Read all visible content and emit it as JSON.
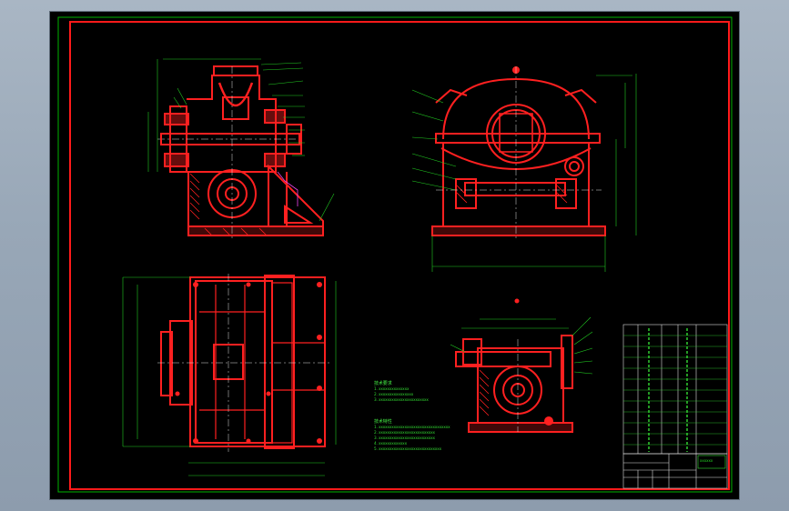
{
  "drawing": {
    "frame_colors": {
      "outer_border": "#00c000",
      "inner_border": "#ff1a1a",
      "part_outline": "#ff2020",
      "dimension": "#22cc22",
      "center_line": "#dddddd",
      "hatch": "#ff2020",
      "background": "#000000"
    },
    "views": [
      "front-section-view",
      "side-view",
      "top-view",
      "partial-section-view"
    ],
    "notes": {
      "block1_title": "技术要求",
      "block1_lines": [
        "1. xxxxxxxxxxxxxx",
        "2. xxxxxxxxxxxxxxxx",
        "3. xxxxxxxxxxxxxxxxxxxxxxx"
      ],
      "block2_title": "技术特性",
      "block2_lines": [
        "1. xxxxxxxxxxxxxxxxxxxxxxxxxxxxxxxxx",
        "2. xxxxxxxxxxxxxxxxxxxxxxxxxx",
        "3. xxxxxxxxxxxxxxxxxxxxxxxxxx",
        "4. xxxxxxxxxxxxx",
        "5. xxxxxxxxxxxxxxxxxxxxxxxxxxxxx"
      ]
    },
    "title_block": {
      "label": "xxxxxx"
    }
  }
}
